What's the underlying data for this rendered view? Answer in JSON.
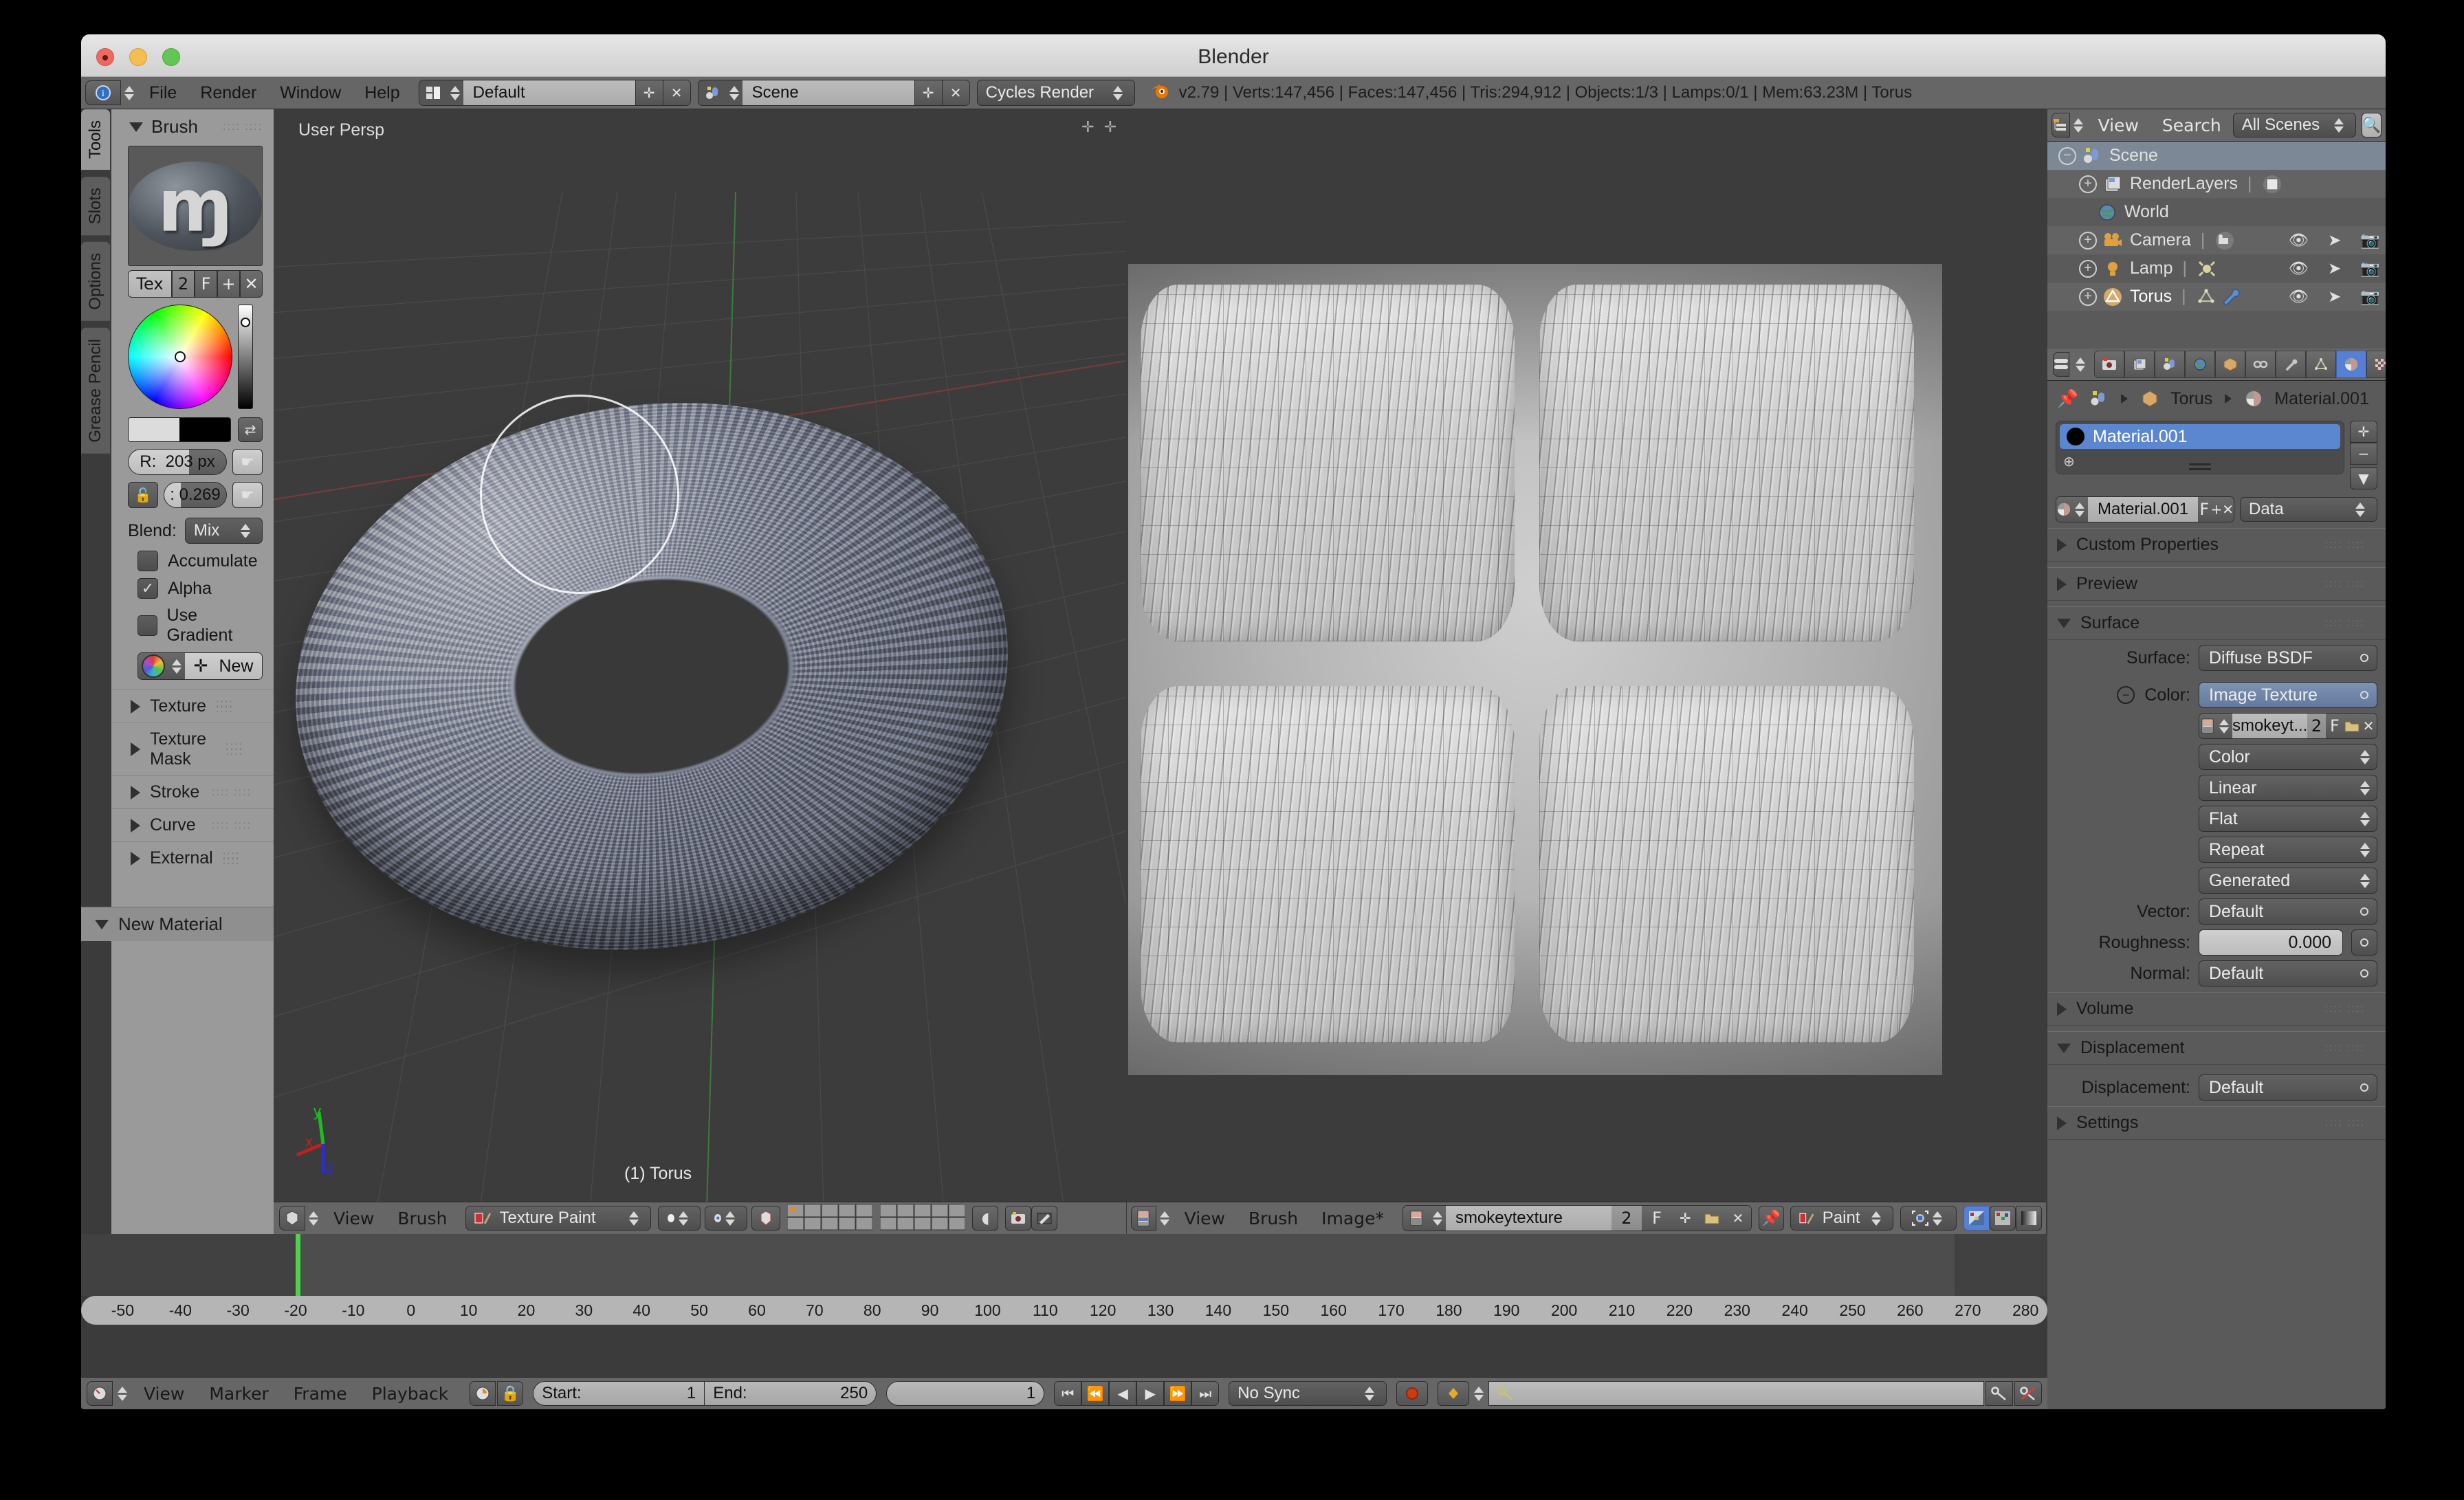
{
  "window": {
    "title": "Blender"
  },
  "topbar": {
    "editor_icon": "info-editor-icon",
    "menus": [
      "File",
      "Render",
      "Window",
      "Help"
    ],
    "screen_layout": "Default",
    "scene_name": "Scene",
    "render_engine": "Cycles Render",
    "stats": "v2.79 | Verts:147,456 | Faces:147,456 | Tris:294,912 | Objects:1/3 | Lamps:0/1 | Mem:63.23M | Torus"
  },
  "toolshelf": {
    "tabs": [
      "Tools",
      "Slots",
      "Options",
      "Grease Pencil"
    ],
    "selected_tab": "Tools",
    "brush_panel": {
      "title": "Brush",
      "tex_label": "Tex",
      "users_count": "2",
      "fake_user": "F",
      "add_label": "+",
      "delete_label": "✕",
      "radius_label": "R:",
      "radius_value": "203 px",
      "strength_label": ":",
      "strength_value": "0.269",
      "blend_label": "Blend:",
      "blend_value": "Mix",
      "checkboxes": [
        {
          "label": "Accumulate",
          "checked": false
        },
        {
          "label": "Alpha",
          "checked": true
        },
        {
          "label": "Use Gradient",
          "checked": false
        }
      ],
      "new_button": "New"
    },
    "collapsed_panels": [
      "Texture",
      "Texture Mask",
      "Stroke",
      "Curve",
      "External"
    ],
    "bottom_panel": "New Material"
  },
  "viewport": {
    "view_label": "User Persp",
    "object_label": "(1) Torus",
    "axis": {
      "x": "x",
      "y": "y",
      "z": "z"
    },
    "header": {
      "menus": [
        "View",
        "Brush"
      ],
      "mode": "Texture Paint",
      "icons": [
        "mode-select-icon",
        "shading-solid-icon",
        "pivot-icon",
        "snap-magnet-icon",
        "layers-icon",
        "layers2-icon",
        "proportional-icon",
        "render-icon",
        "paint-mask-icon"
      ]
    }
  },
  "uv_editor": {
    "header": {
      "editor_icon": "uv-image-editor-icon",
      "menus": [
        "View",
        "Brush",
        "Image*"
      ],
      "image_name": "smokeytexture",
      "users_count": "2",
      "fake_user": "F",
      "add_label": "+",
      "open_label": "open-image-icon",
      "unlink_label": "✕",
      "pin_icon": "pin-icon",
      "mode": "Paint",
      "pivot_icon": "pivot-icon",
      "display_channels": [
        "color-alpha-icon",
        "color-icon",
        "bw-icon"
      ]
    }
  },
  "outliner": {
    "header": {
      "editor_icon": "outliner-icon",
      "menus": [
        "View",
        "Search"
      ],
      "display_mode": "All Scenes",
      "filter_icon": "magnifier-icon"
    },
    "rows": [
      {
        "label": "Scene",
        "icon": "scene-icon",
        "indent": 0,
        "selected": true,
        "expander": "minus"
      },
      {
        "label": "RenderLayers",
        "icon": "renderlayers-icon",
        "indent": 1,
        "selected": false,
        "expander": "plus"
      },
      {
        "label": "World",
        "icon": "world-icon",
        "indent": 1,
        "selected": false,
        "expander": "none"
      },
      {
        "label": "Camera",
        "icon": "camera-icon",
        "indent": 1,
        "selected": false,
        "expander": "plus"
      },
      {
        "label": "Lamp",
        "icon": "lamp-icon",
        "indent": 1,
        "selected": false,
        "expander": "plus"
      },
      {
        "label": "Torus",
        "icon": "mesh-icon",
        "indent": 1,
        "selected": false,
        "expander": "plus"
      }
    ]
  },
  "properties": {
    "tabs": [
      "render-icon",
      "renderlayers-icon",
      "scene-icon",
      "world-icon",
      "object-icon",
      "constraints-icon",
      "modifiers-icon",
      "data-icon",
      "material-icon",
      "texture-icon",
      "particles-icon",
      "physics-icon"
    ],
    "active_tab_index": 8,
    "breadcrumb": [
      "Torus",
      "Material.001"
    ],
    "pin_icon": "pin-icon",
    "material_slot": "Material.001",
    "material_name": "Material.001",
    "fake_user": "F",
    "add_label": "+",
    "unlink_label": "✕",
    "datablock_type": "Data",
    "sections": [
      {
        "label": "Custom Properties",
        "open": false
      },
      {
        "label": "Preview",
        "open": false
      },
      {
        "label": "Surface",
        "open": true
      },
      {
        "label": "Volume",
        "open": false
      },
      {
        "label": "Displacement",
        "open": true
      },
      {
        "label": "Settings",
        "open": false
      }
    ],
    "surface": {
      "surface_label": "Surface:",
      "surface_value": "Diffuse BSDF",
      "color_label": "Color:",
      "color_value": "Image Texture",
      "image_name": "smokeyt...",
      "image_users": "2",
      "image_fake_user": "F",
      "dropdowns": [
        "Color",
        "Linear",
        "Flat",
        "Repeat",
        "Generated"
      ],
      "vector_label": "Vector:",
      "vector_value": "Default",
      "roughness_label": "Roughness:",
      "roughness_value": "0.000",
      "normal_label": "Normal:",
      "normal_value": "Default"
    },
    "displacement": {
      "label": "Displacement:",
      "value": "Default"
    }
  },
  "timeline": {
    "ruler_ticks": [
      "-50",
      "-40",
      "-30",
      "-20",
      "-10",
      "0",
      "10",
      "20",
      "30",
      "40",
      "50",
      "60",
      "70",
      "80",
      "90",
      "100",
      "110",
      "120",
      "130",
      "140",
      "150",
      "160",
      "170",
      "180",
      "190",
      "200",
      "210",
      "220",
      "230",
      "240",
      "250",
      "260",
      "270",
      "280"
    ],
    "playhead_frame": 0,
    "header": {
      "editor_icon": "timeline-icon",
      "menus": [
        "View",
        "Marker",
        "Frame",
        "Playback"
      ],
      "start_label": "Start:",
      "start_value": "1",
      "end_label": "End:",
      "end_value": "250",
      "current_frame": "1",
      "sync_mode": "No Sync",
      "record_icon": "record-icon",
      "keying_set_icon": "keyframe-icon",
      "keying_set_value": "",
      "insert_key_icon": "key-icon",
      "delete_key_icon": "key-remove-icon",
      "transport": [
        "jump-start-icon",
        "prev-keyframe-icon",
        "play-reverse-icon",
        "play-icon",
        "next-keyframe-icon",
        "jump-end-icon"
      ]
    }
  },
  "colors": {
    "accent_blue": "#5b86d0",
    "header_gray": "#666666",
    "panel_gray": "#5a5a5a",
    "toolshelf_gray": "#9a9a9a",
    "viewport_bg": "#3c3c3c",
    "playhead_green": "#4cd34c"
  }
}
